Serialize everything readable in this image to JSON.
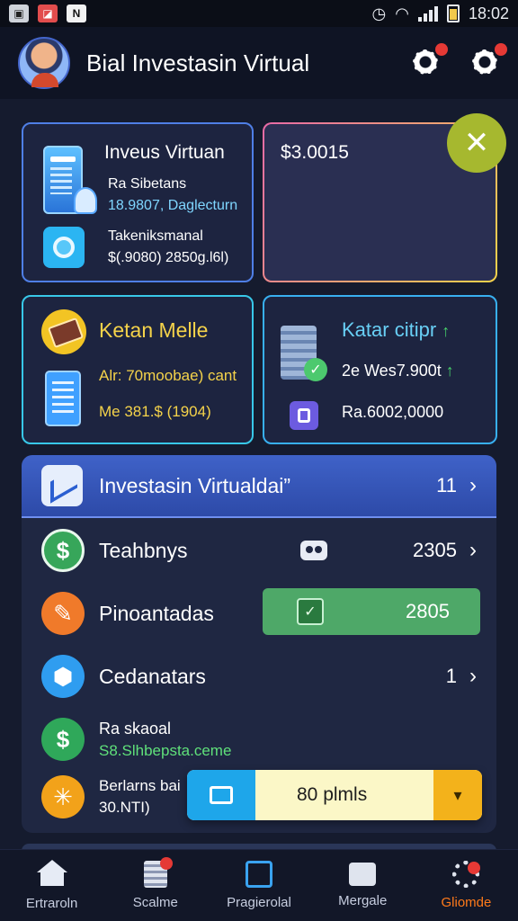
{
  "status_bar": {
    "time": "18:02"
  },
  "header": {
    "title": "Bial Investasin Virtual"
  },
  "cards": {
    "card1": {
      "title": "Inveus Virtuan",
      "line1": "Ra Sibetans",
      "line2": "18.9807, Daglecturn",
      "line3": "Takeniksmanal",
      "line4": "$(.9080) 2850g.l6l)"
    },
    "card2": {
      "amount": "$3.0015",
      "close_symbol": "✕"
    },
    "card3": {
      "title": "Ketan Melle",
      "line1": "Alr: 70moobae) cant",
      "line2": "Me 381.$ (1904)"
    },
    "card4": {
      "title": "Katar citipr",
      "line1": "2e Wes7.900t",
      "line2": "Ra.6002,0000",
      "arrow": "↑",
      "check": "✓"
    }
  },
  "panel": {
    "header": {
      "label": "Investasin Virtualdai”",
      "count": "11",
      "chevron": "›"
    },
    "rows": [
      {
        "icon_symbol": "$",
        "label": "Teahbnys",
        "value": "2305",
        "chevron": "›"
      },
      {
        "icon_symbol": "✎",
        "label": "Pinoantadas",
        "value": "2805",
        "bar_icon": "✓"
      },
      {
        "icon_symbol": "⬢",
        "label": "Cedanatars",
        "value": "1",
        "chevron": "›"
      },
      {
        "icon_symbol": "$",
        "line1": "Ra skaoal",
        "line2": "S8.Slhbepsta.ceme"
      },
      {
        "icon_symbol": "✳",
        "line1": "Berlarns bai",
        "line2": "30.NTI)"
      }
    ],
    "promo": {
      "text": "80 plmls",
      "arrow": "▾"
    }
  },
  "bottom_nav": [
    {
      "label": "Ertraroln",
      "icon": "home-icon"
    },
    {
      "label": "Scalme",
      "icon": "documents-icon"
    },
    {
      "label": "Pragierolal",
      "icon": "chart-icon"
    },
    {
      "label": "Mergale",
      "icon": "message-icon"
    },
    {
      "label": "Gliomde",
      "icon": "settings-icon",
      "active": true
    }
  ],
  "colors": {
    "background": "#151b2e",
    "accent_blue": "#3f62c8",
    "active_orange": "#ff7a1a",
    "yellow_text": "#f5d34a",
    "cyan_text": "#68cff5",
    "green": "#4ea868"
  }
}
